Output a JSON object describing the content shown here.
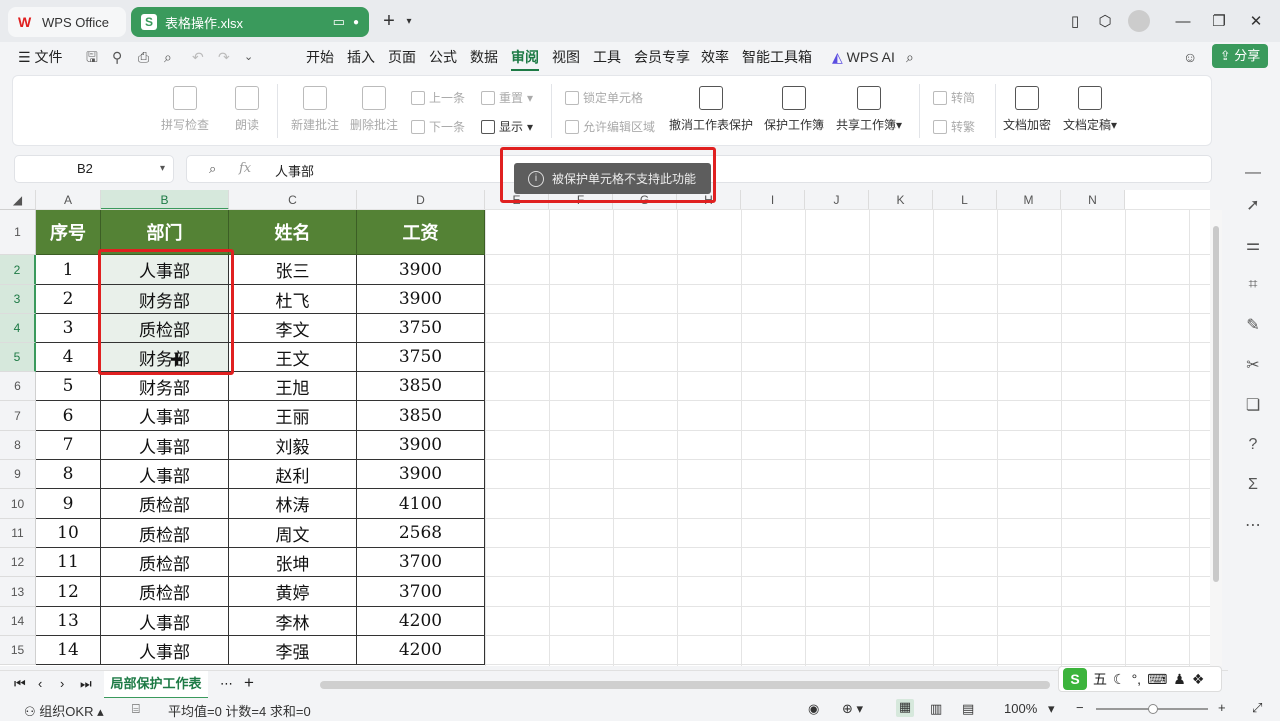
{
  "tabs": {
    "home": "WPS Office",
    "file": "表格操作.xlsx"
  },
  "menu": {
    "file": "文件",
    "items": [
      "开始",
      "插入",
      "页面",
      "公式",
      "数据",
      "审阅",
      "视图",
      "工具",
      "会员专享",
      "效率",
      "智能工具箱"
    ],
    "active_index": 5,
    "wps_ai": "WPS AI",
    "share": "分享"
  },
  "ribbon": {
    "spell": "拼写检查",
    "read": "朗读",
    "new_comment": "新建批注",
    "delete_comment": "删除批注",
    "prev": "上一条",
    "next": "下一条",
    "reset": "重置",
    "show": "显示",
    "lock_cell": "锁定单元格",
    "allow_edit": "允许编辑区域",
    "unprotect_sheet": "撤消工作表保护",
    "protect_workbook": "保护工作簿",
    "share_workbook": "共享工作簿",
    "to_simplified": "转简",
    "to_traditional": "转繁",
    "doc_encrypt": "文档加密",
    "doc_finalize": "文档定稿"
  },
  "formula": {
    "cell_ref": "B2",
    "fx": "fx",
    "value": "人事部"
  },
  "toast": "被保护单元格不支持此功能",
  "columns": [
    "A",
    "B",
    "C",
    "D",
    "E",
    "F",
    "G",
    "H",
    "I",
    "J",
    "K",
    "L",
    "M",
    "N"
  ],
  "table": {
    "headers": [
      "序号",
      "部门",
      "姓名",
      "工资"
    ],
    "rows": [
      [
        "1",
        "人事部",
        "张三",
        "3900"
      ],
      [
        "2",
        "财务部",
        "杜飞",
        "3900"
      ],
      [
        "3",
        "质检部",
        "李文",
        "3750"
      ],
      [
        "4",
        "财务部",
        "王文",
        "3750"
      ],
      [
        "5",
        "财务部",
        "王旭",
        "3850"
      ],
      [
        "6",
        "人事部",
        "王丽",
        "3850"
      ],
      [
        "7",
        "人事部",
        "刘毅",
        "3900"
      ],
      [
        "8",
        "人事部",
        "赵利",
        "3900"
      ],
      [
        "9",
        "质检部",
        "林涛",
        "4100"
      ],
      [
        "10",
        "质检部",
        "周文",
        "2568"
      ],
      [
        "11",
        "质检部",
        "张坤",
        "3700"
      ],
      [
        "12",
        "质检部",
        "黄婷",
        "3700"
      ],
      [
        "13",
        "人事部",
        "李林",
        "4200"
      ],
      [
        "14",
        "人事部",
        "李强",
        "4200"
      ]
    ]
  },
  "row_numbers": [
    "1",
    "2",
    "3",
    "4",
    "5",
    "6",
    "7",
    "8",
    "9",
    "10",
    "11",
    "12",
    "13",
    "14",
    "15"
  ],
  "sheet_tab": "局部保护工作表",
  "status": {
    "okr": "组织OKR",
    "stats": "平均值=0  计数=4  求和=0",
    "zoom": "100%"
  },
  "ime": {
    "mode": "五"
  },
  "colors": {
    "accent": "#3a9a5c",
    "header_bg": "#548235",
    "highlight": "#e02020"
  }
}
